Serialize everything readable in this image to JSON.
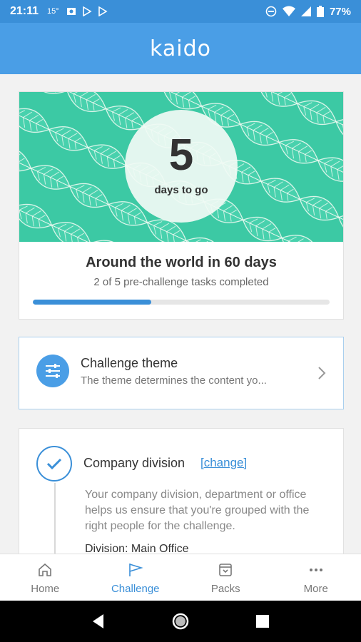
{
  "status_bar": {
    "time": "21:11",
    "temperature": "15°",
    "battery": "77%",
    "icons": [
      "photo-icon",
      "play-store-icon",
      "play-store-icon",
      "do-not-disturb-icon",
      "wifi-icon",
      "signal-icon",
      "battery-icon"
    ]
  },
  "app_bar": {
    "logo_text": "kaido"
  },
  "countdown": {
    "days": "5",
    "label": "days to go",
    "title": "Around the world in 60 days",
    "subtitle": "2 of 5 pre-challenge tasks completed",
    "progress_fraction": 0.4
  },
  "theme_card": {
    "title": "Challenge theme",
    "description": "The theme determines the content yo...",
    "icon": "sliders-icon"
  },
  "division_card": {
    "title": "Company division",
    "change_label": "[change]",
    "description": "Your company division, department or office helps us ensure that you're grouped with the right people for the challenge.",
    "value": "Division: Main Office"
  },
  "bottom_nav": [
    {
      "label": "Home",
      "icon": "home-icon",
      "active": false
    },
    {
      "label": "Challenge",
      "icon": "flag-icon",
      "active": true
    },
    {
      "label": "Packs",
      "icon": "pack-icon",
      "active": false
    },
    {
      "label": "More",
      "icon": "more-icon",
      "active": false
    }
  ],
  "colors": {
    "primary": "#4a9ee6",
    "status_bar": "#3a8fd8",
    "hero_green": "#3cc9a4",
    "text_dark": "#333333",
    "text_muted": "#777777"
  }
}
